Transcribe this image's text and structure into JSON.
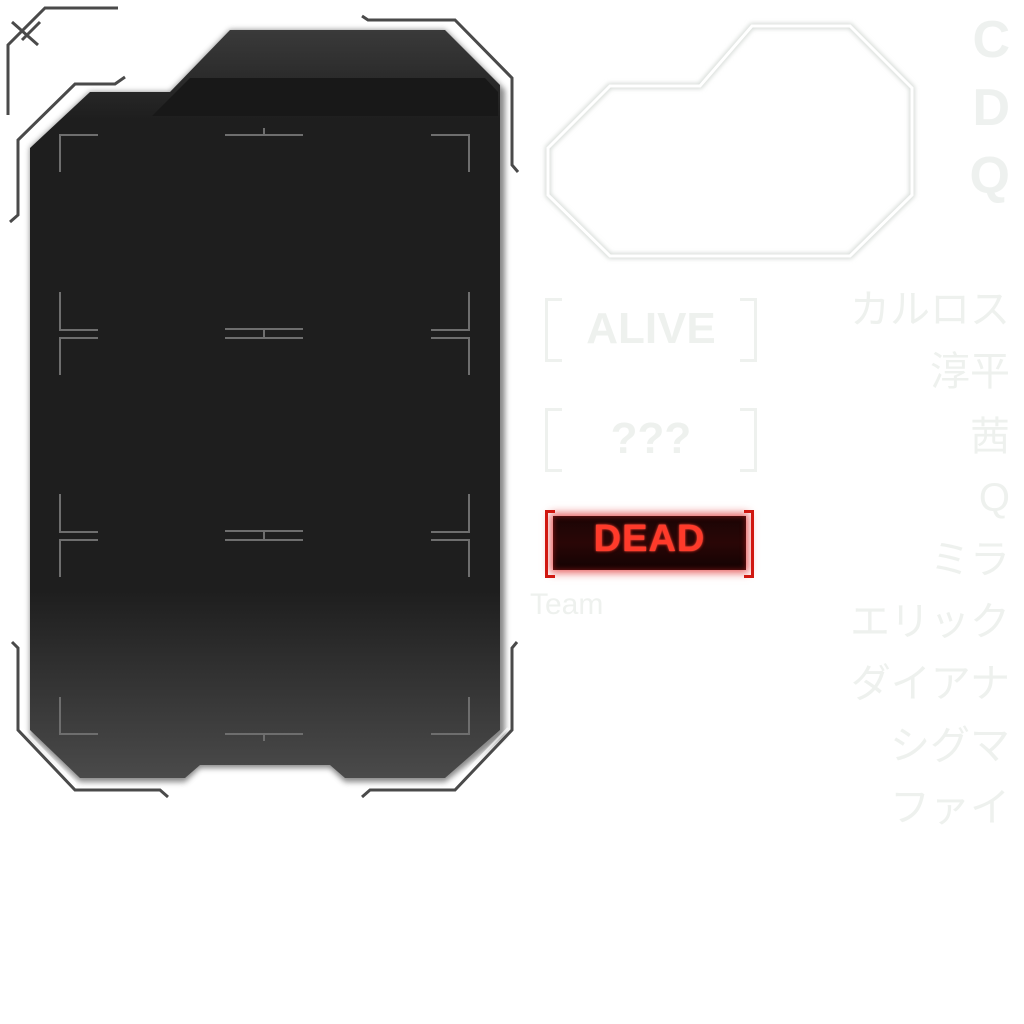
{
  "side_letters": [
    "C",
    "D",
    "Q"
  ],
  "status_labels": {
    "alive": "ALIVE",
    "unknown": "???",
    "dead": "DEAD"
  },
  "team_label": "Team",
  "character_names": [
    "カルロス",
    "淳平",
    "茜",
    "Q",
    "ミラ",
    "エリック",
    "ダイアナ",
    "シグマ",
    "ファイ"
  ],
  "colors": {
    "card_fill": "#1e1e1e",
    "frame_stroke": "#5a5a5a",
    "ghost_text": "#eef1ee",
    "dead_red": "#d01a12"
  }
}
